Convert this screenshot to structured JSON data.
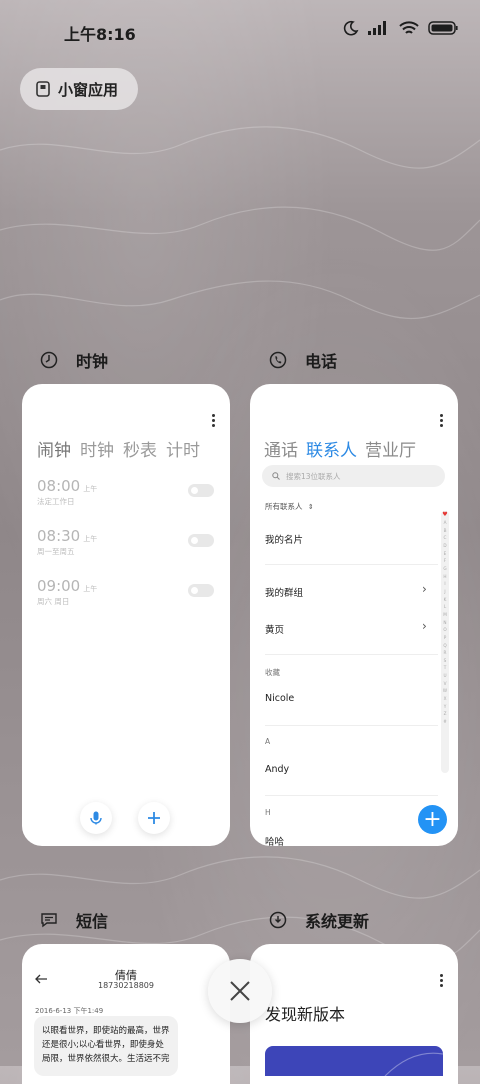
{
  "status_bar": {
    "time": "上午8:16"
  },
  "floating_button": {
    "label": "小窗应用"
  },
  "apps": {
    "clock": {
      "title": "时钟",
      "tabs": [
        "闹钟",
        "时钟",
        "秒表",
        "计时"
      ],
      "alarms": [
        {
          "time": "08:00",
          "ampm": "上午",
          "label": "法定工作日"
        },
        {
          "time": "08:30",
          "ampm": "上午",
          "label": "周一至周五"
        },
        {
          "time": "09:00",
          "ampm": "上午",
          "label": "周六 周日"
        }
      ]
    },
    "phone": {
      "title": "电话",
      "tabs": [
        "通话",
        "联系人",
        "营业厅"
      ],
      "search_placeholder": "搜索13位联系人",
      "all_contacts_label": "所有联系人",
      "my_card": "我的名片",
      "my_groups": "我的群组",
      "yellow_pages": "黄页",
      "favorites_label": "收藏",
      "favorite_contact": "Nicole",
      "section_a": "A",
      "contact_a": "Andy",
      "section_h": "H",
      "contact_h": "哈哈",
      "index_letters": [
        "A",
        "B",
        "C",
        "D",
        "E",
        "F",
        "G",
        "H",
        "I",
        "J",
        "K",
        "L",
        "M",
        "N",
        "O",
        "P",
        "Q",
        "R",
        "S",
        "T",
        "U",
        "V",
        "W",
        "X",
        "Y",
        "Z",
        "#"
      ],
      "add_symbol": "+"
    },
    "sms": {
      "title": "短信",
      "contact_name": "倩倩",
      "contact_number": "18730218809",
      "date": "2016-6-13 下午1:49",
      "message": "以眼看世界，即使站的最高，世界还是很小;以心看世界，即使身处局限，世界依然很大。生活远不完"
    },
    "update": {
      "title": "系统更新",
      "heading": "发现新版本"
    }
  },
  "colors": {
    "accent_blue": "#2d8ae4",
    "fab_blue": "#2393f5",
    "banner_blue": "#3d45b8"
  }
}
